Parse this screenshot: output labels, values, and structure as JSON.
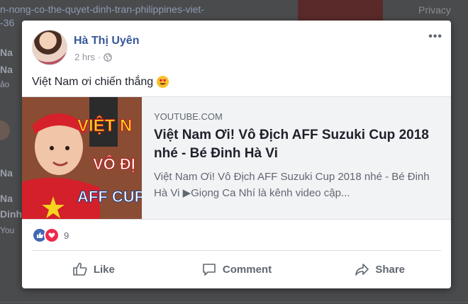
{
  "background": {
    "url_text": "n-nong-co-the-quyet-dinh-tran-philippines-viet-\n-36",
    "privacy_text": "Privacy",
    "left_snippets": [
      "Na",
      "Na",
      "ảo",
      "Na",
      "Dinh",
      "You"
    ]
  },
  "post": {
    "author": "Hà Thị Uyên",
    "time": "2 hrs",
    "more_label": "•••",
    "text": "Việt Nam ơi chiến thắng",
    "emoji": "heart-eyes-emoji"
  },
  "link": {
    "domain": "YOUTUBE.COM",
    "title": "Việt Nam Ơi! Vô Địch AFF Suzuki Cup 2018 nhé - Bé Đinh Hà Vi",
    "description": "Việt Nam Ơi! Vô Địch AFF Suzuki Cup 2018 nhé - Bé Đinh Hà Vi ▶Giọng Ca Nhí là kênh video cập...",
    "thumb_text": [
      "VIỆT N",
      "VÔ ĐỊ",
      "AFF CUP"
    ]
  },
  "reactions": {
    "count": "9"
  },
  "actions": {
    "like": "Like",
    "comment": "Comment",
    "share": "Share"
  },
  "colors": {
    "link_blue": "#365899",
    "like_blue": "#4267b2",
    "love_red": "#f0284a"
  }
}
